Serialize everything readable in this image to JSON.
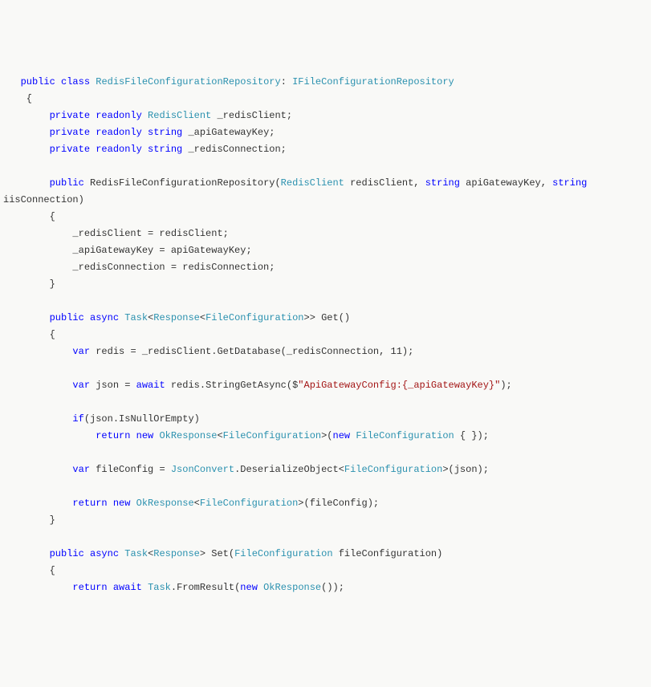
{
  "code": {
    "lines": [
      [
        {
          "cls": "txt",
          "t": "   "
        },
        {
          "cls": "kw",
          "t": "public"
        },
        {
          "cls": "txt",
          "t": " "
        },
        {
          "cls": "kw",
          "t": "class"
        },
        {
          "cls": "txt",
          "t": " "
        },
        {
          "cls": "type",
          "t": "RedisFileConfigurationRepository"
        },
        {
          "cls": "txt",
          "t": ": "
        },
        {
          "cls": "type",
          "t": "IFileConfigurationRepository"
        }
      ],
      [
        {
          "cls": "txt",
          "t": "    {"
        }
      ],
      [
        {
          "cls": "txt",
          "t": "        "
        },
        {
          "cls": "kw",
          "t": "private"
        },
        {
          "cls": "txt",
          "t": " "
        },
        {
          "cls": "kw",
          "t": "readonly"
        },
        {
          "cls": "txt",
          "t": " "
        },
        {
          "cls": "type",
          "t": "RedisClient"
        },
        {
          "cls": "txt",
          "t": " _redisClient;"
        }
      ],
      [
        {
          "cls": "txt",
          "t": "        "
        },
        {
          "cls": "kw",
          "t": "private"
        },
        {
          "cls": "txt",
          "t": " "
        },
        {
          "cls": "kw",
          "t": "readonly"
        },
        {
          "cls": "txt",
          "t": " "
        },
        {
          "cls": "kw",
          "t": "string"
        },
        {
          "cls": "txt",
          "t": " _apiGatewayKey;"
        }
      ],
      [
        {
          "cls": "txt",
          "t": "        "
        },
        {
          "cls": "kw",
          "t": "private"
        },
        {
          "cls": "txt",
          "t": " "
        },
        {
          "cls": "kw",
          "t": "readonly"
        },
        {
          "cls": "txt",
          "t": " "
        },
        {
          "cls": "kw",
          "t": "string"
        },
        {
          "cls": "txt",
          "t": " _redisConnection;"
        }
      ],
      [
        {
          "cls": "txt",
          "t": ""
        }
      ],
      [
        {
          "cls": "txt",
          "t": "        "
        },
        {
          "cls": "kw",
          "t": "public"
        },
        {
          "cls": "txt",
          "t": " RedisFileConfigurationRepository("
        },
        {
          "cls": "type",
          "t": "RedisClient"
        },
        {
          "cls": "txt",
          "t": " redisClient, "
        },
        {
          "cls": "kw",
          "t": "string"
        },
        {
          "cls": "txt",
          "t": " apiGatewayKey, "
        },
        {
          "cls": "kw",
          "t": "string"
        },
        {
          "cls": "txt",
          "t": " "
        }
      ],
      [
        {
          "cls": "txt",
          "t": "iisConnection)"
        }
      ],
      [
        {
          "cls": "txt",
          "t": "        {"
        }
      ],
      [
        {
          "cls": "txt",
          "t": "            _redisClient = redisClient;"
        }
      ],
      [
        {
          "cls": "txt",
          "t": "            _apiGatewayKey = apiGatewayKey;"
        }
      ],
      [
        {
          "cls": "txt",
          "t": "            _redisConnection = redisConnection;"
        }
      ],
      [
        {
          "cls": "txt",
          "t": "        }"
        }
      ],
      [
        {
          "cls": "txt",
          "t": ""
        }
      ],
      [
        {
          "cls": "txt",
          "t": "        "
        },
        {
          "cls": "kw",
          "t": "public"
        },
        {
          "cls": "txt",
          "t": " "
        },
        {
          "cls": "kw",
          "t": "async"
        },
        {
          "cls": "txt",
          "t": " "
        },
        {
          "cls": "type",
          "t": "Task"
        },
        {
          "cls": "txt",
          "t": "<"
        },
        {
          "cls": "type",
          "t": "Response"
        },
        {
          "cls": "txt",
          "t": "<"
        },
        {
          "cls": "type",
          "t": "FileConfiguration"
        },
        {
          "cls": "txt",
          "t": ">> Get()"
        }
      ],
      [
        {
          "cls": "txt",
          "t": "        {"
        }
      ],
      [
        {
          "cls": "txt",
          "t": "            "
        },
        {
          "cls": "kw",
          "t": "var"
        },
        {
          "cls": "txt",
          "t": " redis = _redisClient.GetDatabase(_redisConnection, 11);"
        }
      ],
      [
        {
          "cls": "txt",
          "t": ""
        }
      ],
      [
        {
          "cls": "txt",
          "t": "            "
        },
        {
          "cls": "kw",
          "t": "var"
        },
        {
          "cls": "txt",
          "t": " json = "
        },
        {
          "cls": "kw",
          "t": "await"
        },
        {
          "cls": "txt",
          "t": " redis.StringGetAsync($"
        },
        {
          "cls": "str",
          "t": "\"ApiGatewayConfig:{_apiGatewayKey}\""
        },
        {
          "cls": "txt",
          "t": ");"
        }
      ],
      [
        {
          "cls": "txt",
          "t": ""
        }
      ],
      [
        {
          "cls": "txt",
          "t": "            "
        },
        {
          "cls": "kw",
          "t": "if"
        },
        {
          "cls": "txt",
          "t": "(json.IsNullOrEmpty)"
        }
      ],
      [
        {
          "cls": "txt",
          "t": "                "
        },
        {
          "cls": "kw",
          "t": "return"
        },
        {
          "cls": "txt",
          "t": " "
        },
        {
          "cls": "kw",
          "t": "new"
        },
        {
          "cls": "txt",
          "t": " "
        },
        {
          "cls": "type",
          "t": "OkResponse"
        },
        {
          "cls": "txt",
          "t": "<"
        },
        {
          "cls": "type",
          "t": "FileConfiguration"
        },
        {
          "cls": "txt",
          "t": ">("
        },
        {
          "cls": "kw",
          "t": "new"
        },
        {
          "cls": "txt",
          "t": " "
        },
        {
          "cls": "type",
          "t": "FileConfiguration"
        },
        {
          "cls": "txt",
          "t": " { });"
        }
      ],
      [
        {
          "cls": "txt",
          "t": ""
        }
      ],
      [
        {
          "cls": "txt",
          "t": "            "
        },
        {
          "cls": "kw",
          "t": "var"
        },
        {
          "cls": "txt",
          "t": " fileConfig = "
        },
        {
          "cls": "type",
          "t": "JsonConvert"
        },
        {
          "cls": "txt",
          "t": ".DeserializeObject<"
        },
        {
          "cls": "type",
          "t": "FileConfiguration"
        },
        {
          "cls": "txt",
          "t": ">(json);"
        }
      ],
      [
        {
          "cls": "txt",
          "t": ""
        }
      ],
      [
        {
          "cls": "txt",
          "t": "            "
        },
        {
          "cls": "kw",
          "t": "return"
        },
        {
          "cls": "txt",
          "t": " "
        },
        {
          "cls": "kw",
          "t": "new"
        },
        {
          "cls": "txt",
          "t": " "
        },
        {
          "cls": "type",
          "t": "OkResponse"
        },
        {
          "cls": "txt",
          "t": "<"
        },
        {
          "cls": "type",
          "t": "FileConfiguration"
        },
        {
          "cls": "txt",
          "t": ">(fileConfig);"
        }
      ],
      [
        {
          "cls": "txt",
          "t": "        }"
        }
      ],
      [
        {
          "cls": "txt",
          "t": ""
        }
      ],
      [
        {
          "cls": "txt",
          "t": "        "
        },
        {
          "cls": "kw",
          "t": "public"
        },
        {
          "cls": "txt",
          "t": " "
        },
        {
          "cls": "kw",
          "t": "async"
        },
        {
          "cls": "txt",
          "t": " "
        },
        {
          "cls": "type",
          "t": "Task"
        },
        {
          "cls": "txt",
          "t": "<"
        },
        {
          "cls": "type",
          "t": "Response"
        },
        {
          "cls": "txt",
          "t": "> Set("
        },
        {
          "cls": "type",
          "t": "FileConfiguration"
        },
        {
          "cls": "txt",
          "t": " fileConfiguration)"
        }
      ],
      [
        {
          "cls": "txt",
          "t": "        {"
        }
      ],
      [
        {
          "cls": "txt",
          "t": "            "
        },
        {
          "cls": "kw",
          "t": "return"
        },
        {
          "cls": "txt",
          "t": " "
        },
        {
          "cls": "kw",
          "t": "await"
        },
        {
          "cls": "txt",
          "t": " "
        },
        {
          "cls": "type",
          "t": "Task"
        },
        {
          "cls": "txt",
          "t": ".FromResult("
        },
        {
          "cls": "kw",
          "t": "new"
        },
        {
          "cls": "txt",
          "t": " "
        },
        {
          "cls": "type",
          "t": "OkResponse"
        },
        {
          "cls": "txt",
          "t": "());"
        }
      ]
    ]
  }
}
